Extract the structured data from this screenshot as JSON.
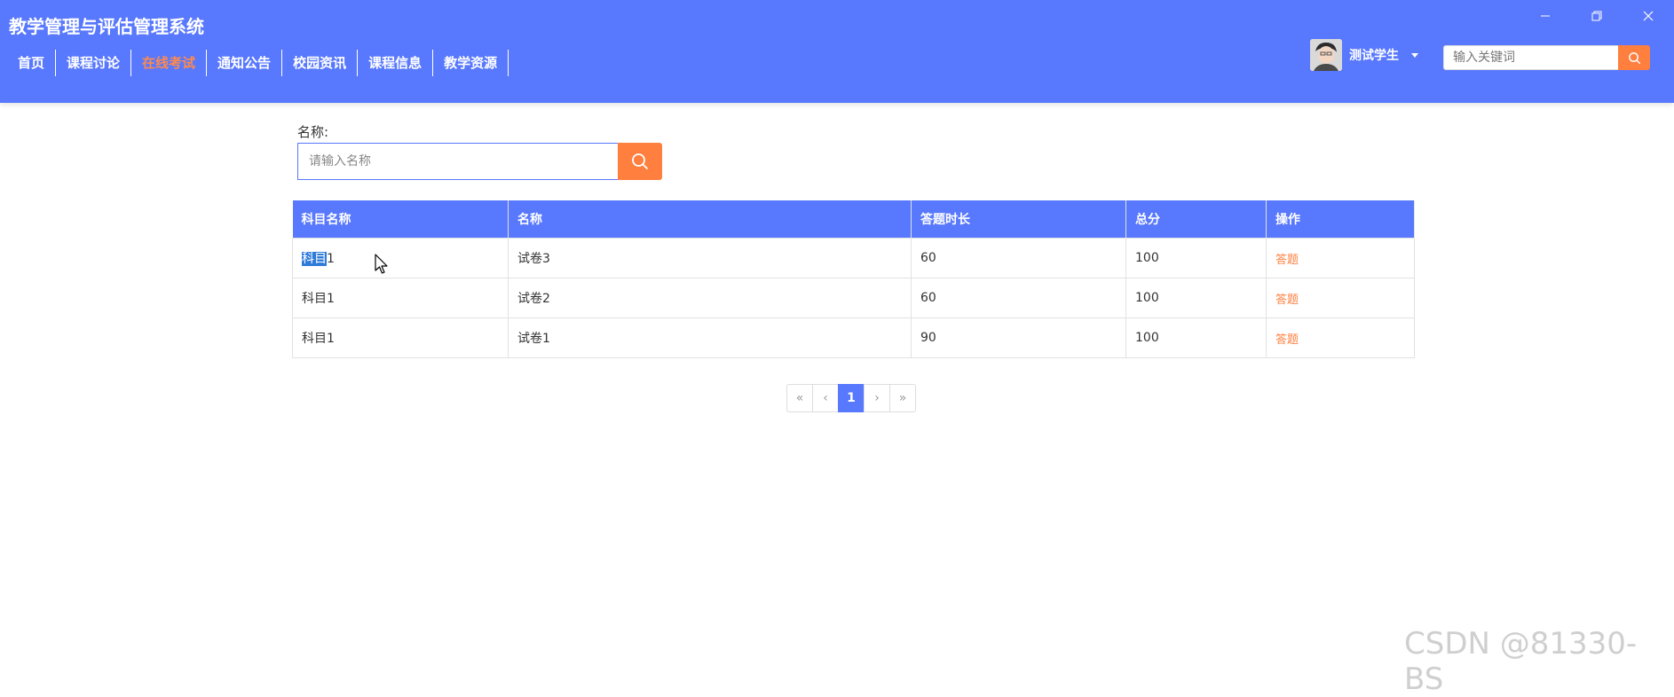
{
  "app": {
    "title": "教学管理与评估管理系统"
  },
  "nav": {
    "items": [
      {
        "label": "首页"
      },
      {
        "label": "课程讨论"
      },
      {
        "label": "在线考试",
        "active": true
      },
      {
        "label": "通知公告"
      },
      {
        "label": "校园资讯"
      },
      {
        "label": "课程信息"
      },
      {
        "label": "教学资源"
      }
    ]
  },
  "user": {
    "name": "测试学生"
  },
  "top_search": {
    "placeholder": "输入关键词",
    "value": ""
  },
  "filter": {
    "label": "名称:",
    "placeholder": "请输入名称",
    "value": ""
  },
  "table": {
    "headers": [
      "科目名称",
      "名称",
      "答题时长",
      "总分",
      "操作"
    ],
    "rows": [
      {
        "subject_selected": "科目",
        "subject_rest": "1",
        "name": "试卷3",
        "duration": "60",
        "score": "100",
        "action": "答题"
      },
      {
        "subject": "科目1",
        "name": "试卷2",
        "duration": "60",
        "score": "100",
        "action": "答题"
      },
      {
        "subject": "科目1",
        "name": "试卷1",
        "duration": "90",
        "score": "100",
        "action": "答题"
      }
    ]
  },
  "pagination": {
    "first": "«",
    "prev": "‹",
    "current": "1",
    "next": "›",
    "last": "»"
  },
  "watermark": "CSDN @81330-BS",
  "colors": {
    "primary": "#5878fd",
    "accent": "#ff7f3f",
    "active_nav": "#ff8a4c"
  }
}
